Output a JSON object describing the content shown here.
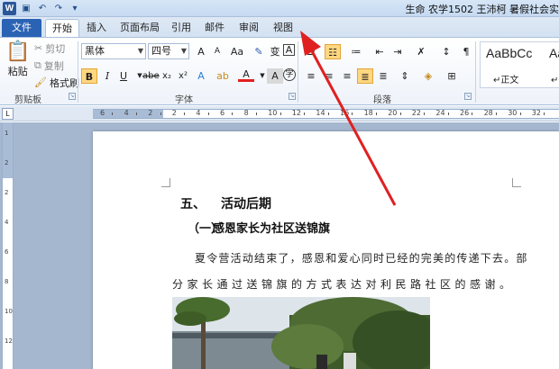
{
  "titlebar": {
    "app_icon": "W",
    "document_title": "生命 农学1502 王沛柯 暑假社会实"
  },
  "quick_access": [
    "save-icon",
    "undo-icon",
    "redo-icon",
    "customize-icon"
  ],
  "tabs": [
    {
      "label": "文件"
    },
    {
      "label": "开始"
    },
    {
      "label": "插入"
    },
    {
      "label": "页面布局"
    },
    {
      "label": "引用"
    },
    {
      "label": "邮件"
    },
    {
      "label": "审阅"
    },
    {
      "label": "视图"
    }
  ],
  "clipboard": {
    "paste": "粘贴",
    "cut": "剪切",
    "copy": "复制",
    "format_painter": "格式刷",
    "group_label": "剪贴板"
  },
  "font": {
    "font_name": "黑体",
    "font_size": "四号",
    "group_label": "字体",
    "grow": "A",
    "shrink": "A",
    "bold": "B",
    "italic": "I",
    "underline": "U",
    "strikethrough": "abe",
    "subscript": "x₂",
    "superscript": "x²",
    "char_border": "A",
    "font_color": "A",
    "accent_color": "#e02020"
  },
  "paragraph": {
    "group_label": "段落"
  },
  "styles": {
    "sample_1": "AaBbCc",
    "sample_2": "AaBb",
    "name_1": "↵正文",
    "name_2": "↵无"
  },
  "ruler": {
    "numbers": [
      "6",
      "4",
      "2",
      "2",
      "4",
      "6",
      "8",
      "10",
      "12",
      "14",
      "16",
      "18",
      "20",
      "22",
      "24",
      "26",
      "28",
      "30",
      "32"
    ],
    "vnumbers": [
      "1",
      "2",
      "2",
      "4",
      "6",
      "8",
      "10",
      "12"
    ]
  },
  "document": {
    "heading1_num": "五、",
    "heading1_text": "活动后期",
    "heading2_num": "（一）",
    "heading2_text": "感恩家长为社区送锦旗",
    "para_line1": "夏令营活动结束了，感恩和爱心同时已经的完美的传递下去。部",
    "para_line2": "分家长通过送锦旗的方式表达对利民路社区的感谢。"
  }
}
